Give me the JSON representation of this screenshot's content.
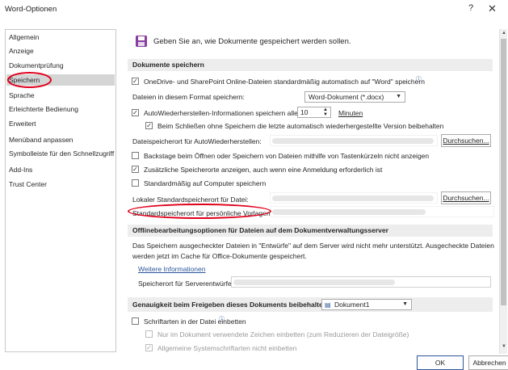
{
  "window": {
    "title": "Word-Optionen",
    "help_glyph": "?",
    "close_glyph": "✕"
  },
  "nav": [
    "Allgemein",
    "Anzeige",
    "Dokumentprüfung",
    "Speichern",
    "Sprache",
    "Erleichterte Bedienung",
    "Erweitert",
    "Menüband anpassen",
    "Symbolleiste für den Schnellzugriff",
    "Add-Ins",
    "Trust Center"
  ],
  "header": {
    "text": "Geben Sie an, wie Dokumente gespeichert werden sollen."
  },
  "save": {
    "heading": "Dokumente speichern",
    "onedrive_label": "OneDrive- und SharePoint Online-Dateien standardmäßig automatisch auf \"Word\" speichern",
    "format_label": "Dateien in diesem Format speichern:",
    "format_value": "Word-Dokument (*.docx)",
    "autorecover_label": "AutoWiederherstellen-Informationen speichern alle",
    "autorecover_minutes": "10",
    "minutes_label": "Minuten",
    "keep_last_label": "Beim Schließen ohne Speichern die letzte automatisch wiederhergestellte Version beibehalten",
    "autorecover_location_label": "Dateispeicherort für AutoWiederherstellen:",
    "browse_label": "Durchsuchen...",
    "backstage_label": "Backstage beim Öffnen oder Speichern von Dateien mithilfe von Tastenkürzeln nicht anzeigen",
    "additional_label": "Zusätzliche Speicherorte anzeigen, auch wenn eine Anmeldung erforderlich ist",
    "default_computer_label": "Standardmäßig auf Computer speichern",
    "local_default_label": "Lokaler Standardspeicherort für Datei:",
    "browse_label_2": "Durchsuchen...",
    "personal_templates_label": "Standardspeicherort für persönliche Vorlagen:"
  },
  "offline": {
    "heading": "Offlinebearbeitungsoptionen für Dateien auf dem Dokumentverwaltungsserver",
    "desc_line1": "Das Speichern ausgecheckter Dateien in \"Entwürfe\" auf dem Server wird nicht mehr unterstützt. Ausgecheckte Dateien",
    "desc_line2": "werden jetzt im Cache für Office-Dokumente gespeichert.",
    "link": "Weitere Informationen",
    "server_drafts_label": "Speicherort für Serverentwürfe:"
  },
  "fidelity": {
    "heading": "Genauigkeit beim Freigeben dieses Dokuments beibehalten:",
    "document": "Dokument1",
    "embed_fonts_label": "Schriftarten in der Datei einbetten",
    "embed_used_label": "Nur im Dokument verwendete Zeichen einbetten (zum Reduzieren der Dateigröße)",
    "no_common_label": "Allgemeine Systemschriftarten nicht einbetten"
  },
  "footer": {
    "ok": "OK",
    "cancel": "Abbrechen"
  },
  "colors": {
    "annotation_red": "#e0001b",
    "link_blue": "#2b579a",
    "save_icon_purple": "#8a3f9e"
  }
}
